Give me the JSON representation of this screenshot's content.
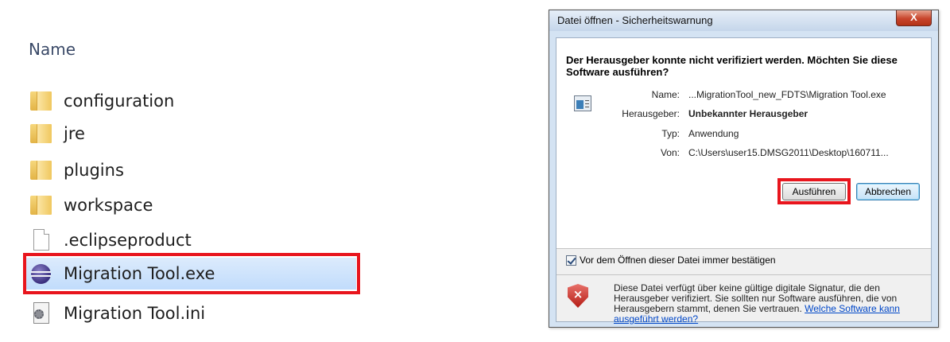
{
  "explorer": {
    "column_header": "Name",
    "files": [
      {
        "name": "configuration",
        "icon": "folder-icon"
      },
      {
        "name": "jre",
        "icon": "folder-icon"
      },
      {
        "name": "plugins",
        "icon": "folder-icon"
      },
      {
        "name": "workspace",
        "icon": "folder-icon"
      },
      {
        "name": ".eclipseproduct",
        "icon": "file-icon"
      },
      {
        "name": "Migration Tool.exe",
        "icon": "eclipse-icon",
        "selected": true
      },
      {
        "name": "Migration Tool.ini",
        "icon": "ini-file-icon"
      }
    ]
  },
  "dialog": {
    "title": "Datei öffnen - Sicherheitswarnung",
    "close_label": "X",
    "heading": "Der Herausgeber konnte nicht verifiziert werden. Möchten Sie diese Software ausführen?",
    "info": {
      "name_label": "Name:",
      "name_value": "...MigrationTool_new_FDTS\\Migration Tool.exe",
      "publisher_label": "Herausgeber:",
      "publisher_value": "Unbekannter Herausgeber",
      "type_label": "Typ:",
      "type_value": "Anwendung",
      "from_label": "Von:",
      "from_value": "C:\\Users\\user15.DMSG2011\\Desktop\\160711..."
    },
    "run_button": "Ausführen",
    "cancel_button": "Abbrechen",
    "checkbox_label": "Vor dem Öffnen dieser Datei immer bestätigen",
    "checkbox_checked": true,
    "warning_text": "Diese Datei verfügt über keine gültige digitale Signatur, die den Herausgeber verifiziert. Sie sollten nur Software ausführen, die von Herausgebern stammt, denen Sie vertrauen.",
    "warning_link": "Welche Software kann ausgeführt werden?"
  },
  "colors": {
    "highlight": "#e8151d",
    "selection": "#c1dcfc",
    "link": "#0047c8"
  }
}
